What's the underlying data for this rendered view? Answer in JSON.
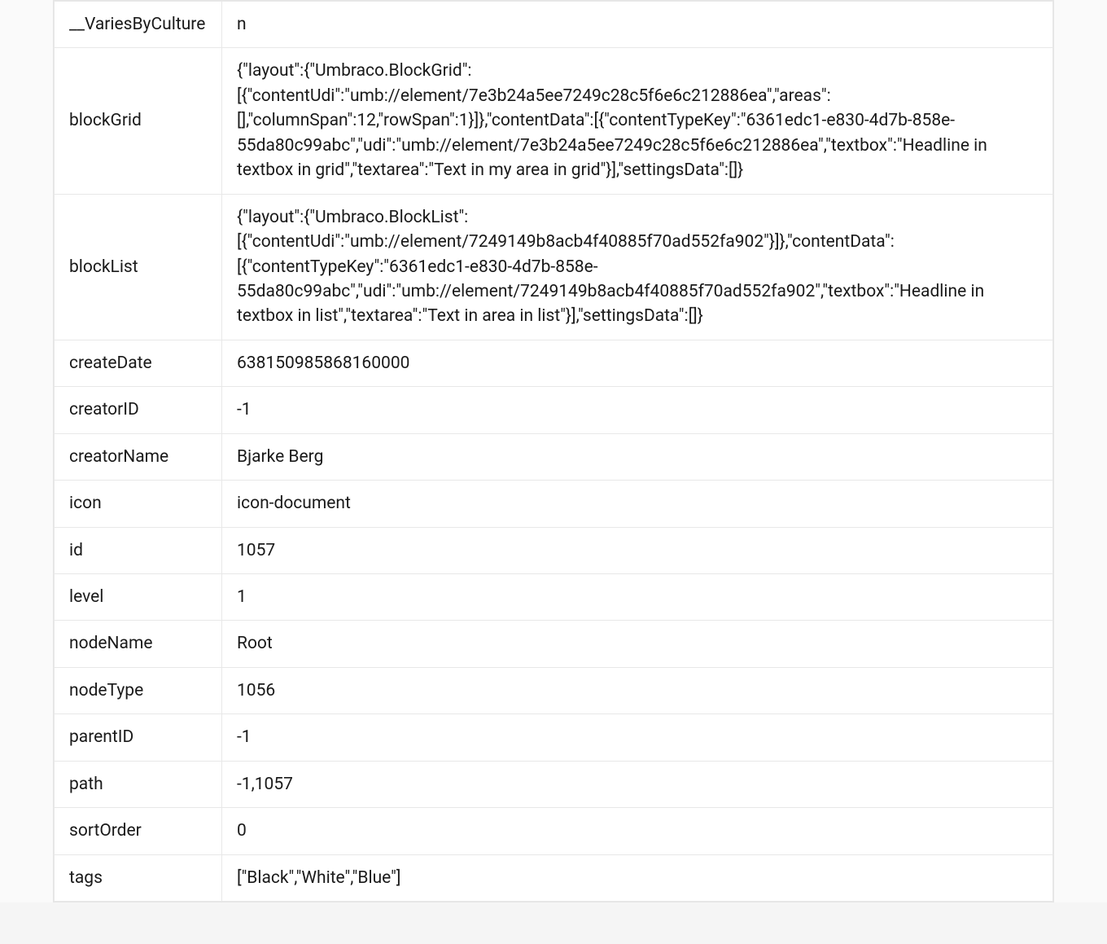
{
  "rows": [
    {
      "key": "__VariesByCulture",
      "value": "n"
    },
    {
      "key": "blockGrid",
      "value": "{\"layout\":{\"Umbraco.BlockGrid\":[{\"contentUdi\":\"umb://element/7e3b24a5ee7249c28c5f6e6c212886ea\",\"areas\":[],\"columnSpan\":12,\"rowSpan\":1}]},\"contentData\":[{\"contentTypeKey\":\"6361edc1-e830-4d7b-858e-55da80c99abc\",\"udi\":\"umb://element/7e3b24a5ee7249c28c5f6e6c212886ea\",\"textbox\":\"Headline in textbox in grid\",\"textarea\":\"Text in my area in grid\"}],\"settingsData\":[]}"
    },
    {
      "key": "blockList",
      "value": "{\"layout\":{\"Umbraco.BlockList\":[{\"contentUdi\":\"umb://element/7249149b8acb4f40885f70ad552fa902\"}]},\"contentData\":[{\"contentTypeKey\":\"6361edc1-e830-4d7b-858e-55da80c99abc\",\"udi\":\"umb://element/7249149b8acb4f40885f70ad552fa902\",\"textbox\":\"Headline in textbox in list\",\"textarea\":\"Text in area in list\"}],\"settingsData\":[]}"
    },
    {
      "key": "createDate",
      "value": "638150985868160000"
    },
    {
      "key": "creatorID",
      "value": "-1"
    },
    {
      "key": "creatorName",
      "value": "Bjarke Berg"
    },
    {
      "key": "icon",
      "value": "icon-document"
    },
    {
      "key": "id",
      "value": "1057"
    },
    {
      "key": "level",
      "value": "1"
    },
    {
      "key": "nodeName",
      "value": "Root"
    },
    {
      "key": "nodeType",
      "value": "1056"
    },
    {
      "key": "parentID",
      "value": "-1"
    },
    {
      "key": "path",
      "value": "-1,1057"
    },
    {
      "key": "sortOrder",
      "value": "0"
    },
    {
      "key": "tags",
      "value": "[\"Black\",\"White\",\"Blue\"]"
    }
  ]
}
